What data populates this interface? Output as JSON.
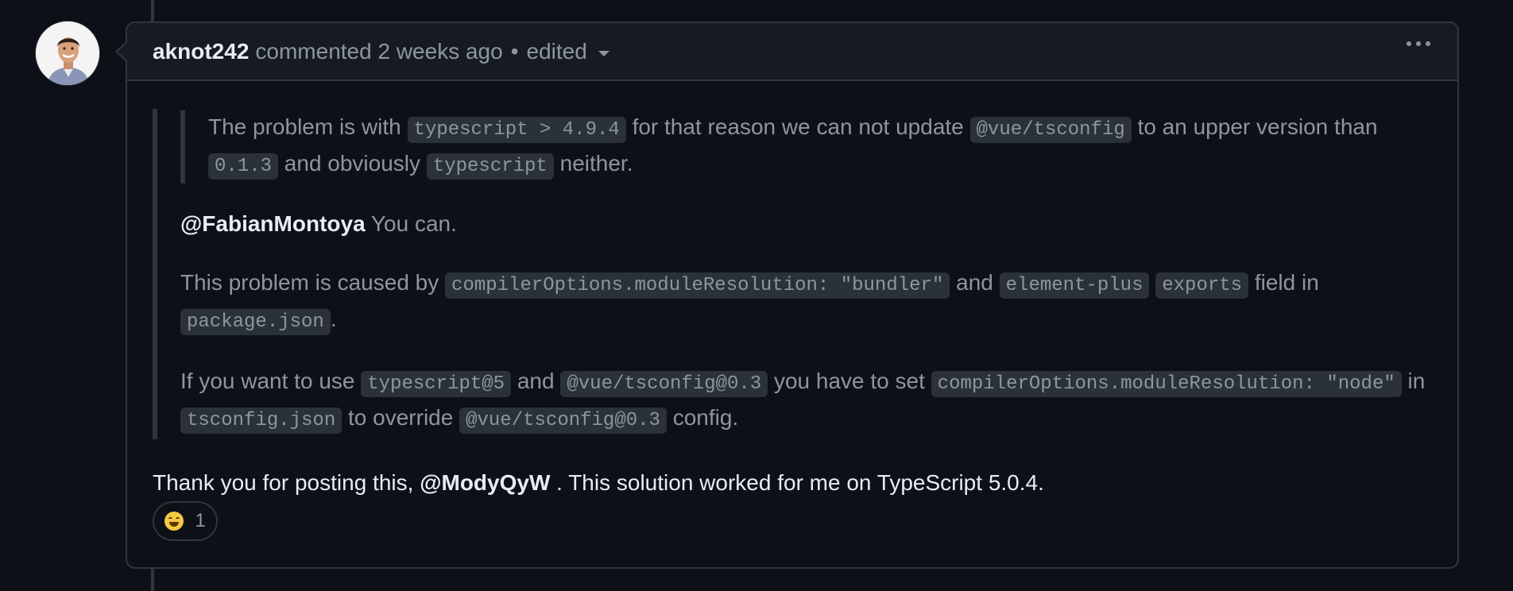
{
  "comment": {
    "author": "aknot242",
    "meta": "commented 2 weeks ago",
    "separator": "•",
    "edited_label": "edited",
    "quote": {
      "inner": {
        "t1": "The problem is with ",
        "c1": "typescript > 4.9.4",
        "t2": " for that reason we can not update ",
        "c2": "@vue/tsconfig",
        "t3": " to an upper version than ",
        "c3": "0.1.3",
        "t4": " and obviously ",
        "c4": "typescript",
        "t5": " neither."
      },
      "p1": {
        "mention": "@FabianMontoya",
        "text": " You can."
      },
      "p2": {
        "t1": "This problem is caused by ",
        "c1": "compilerOptions.moduleResolution: \"bundler\"",
        "t2": " and ",
        "c2": "element-plus",
        "t3": " ",
        "c3": "exports",
        "t4": " field in ",
        "c4": "package.json",
        "t5": "."
      },
      "p3": {
        "t1": "If you want to use ",
        "c1": "typescript@5",
        "t2": " and ",
        "c2": "@vue/tsconfig@0.3",
        "t3": " you have to set ",
        "c3": "compilerOptions.moduleResolution: \"node\"",
        "t4": " in ",
        "c4": "tsconfig.json",
        "t5": " to override ",
        "c5": "@vue/tsconfig@0.3",
        "t6": " config."
      }
    },
    "thanks": {
      "t1": "Thank you for posting this, ",
      "mention": "@ModyQyW",
      "t2": " . This solution worked for me on TypeScript 5.0.4."
    },
    "reaction": {
      "icon": "grinning-face-emoji",
      "count": "1"
    }
  },
  "colors": {
    "background": "#0d1117",
    "header_bg": "#161b22",
    "border": "#30363d",
    "text_primary": "#e6edf3",
    "text_muted": "#8d96a0",
    "code_bg": "#2b3138"
  }
}
